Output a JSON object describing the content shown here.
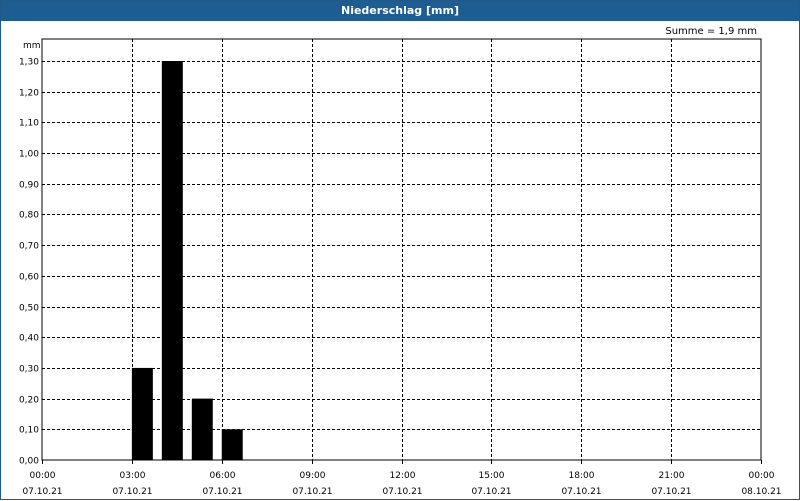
{
  "window": {
    "title": "Niederschlag [mm]"
  },
  "summary": {
    "text": "Summe = 1,9 mm"
  },
  "chart_data": {
    "type": "bar",
    "title": "Niederschlag [mm]",
    "ylabel": "mm",
    "ylim": [
      0,
      1.3
    ],
    "yticks": [
      "0,00",
      "0,10",
      "0,20",
      "0,30",
      "0,40",
      "0,50",
      "0,60",
      "0,70",
      "0,80",
      "0,90",
      "1,00",
      "1,10",
      "1,20",
      "1,30"
    ],
    "xlim_hours": [
      0,
      24
    ],
    "xticks": [
      {
        "time": "00:00",
        "date": "07.10.21"
      },
      {
        "time": "03:00",
        "date": "07.10.21"
      },
      {
        "time": "06:00",
        "date": "07.10.21"
      },
      {
        "time": "09:00",
        "date": "07.10.21"
      },
      {
        "time": "12:00",
        "date": "07.10.21"
      },
      {
        "time": "15:00",
        "date": "07.10.21"
      },
      {
        "time": "18:00",
        "date": "07.10.21"
      },
      {
        "time": "21:00",
        "date": "07.10.21"
      },
      {
        "time": "00:00",
        "date": "08.10.21"
      }
    ],
    "bars": [
      {
        "start": "03:00",
        "end": "04:00",
        "value": 0.3
      },
      {
        "start": "04:00",
        "end": "05:00",
        "value": 1.3
      },
      {
        "start": "05:00",
        "end": "06:00",
        "value": 0.2
      },
      {
        "start": "06:00",
        "end": "07:00",
        "value": 0.1
      }
    ],
    "grid": true,
    "bar_color": "#000000"
  }
}
